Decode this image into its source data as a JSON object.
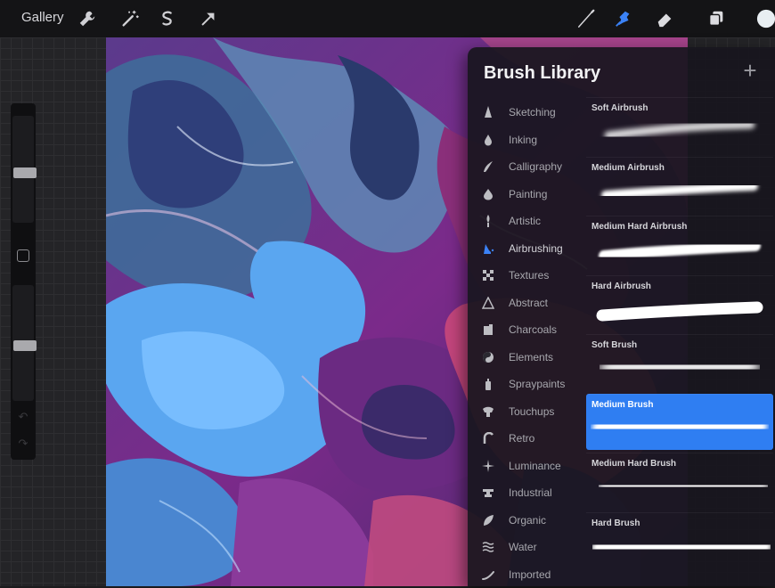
{
  "toolbar": {
    "gallery_label": "Gallery",
    "left_tools": [
      "wrench-icon",
      "magic-wand-icon",
      "selection-icon",
      "transform-icon"
    ],
    "right_tools": [
      "brush-icon",
      "smudge-icon",
      "eraser-icon",
      "layers-icon",
      "color-swatch"
    ],
    "active_tool": "smudge",
    "accent_color": "#3b82f6",
    "current_color": "#e8eef2"
  },
  "panel": {
    "title": "Brush Library",
    "add_label": "+"
  },
  "categories": [
    {
      "label": "Sketching",
      "icon": "pencil-tip-icon"
    },
    {
      "label": "Inking",
      "icon": "ink-drop-icon"
    },
    {
      "label": "Calligraphy",
      "icon": "calligraphy-icon"
    },
    {
      "label": "Painting",
      "icon": "paint-drop-icon"
    },
    {
      "label": "Artistic",
      "icon": "artistic-brush-icon"
    },
    {
      "label": "Airbrushing",
      "icon": "airbrush-icon",
      "active": true
    },
    {
      "label": "Textures",
      "icon": "texture-icon"
    },
    {
      "label": "Abstract",
      "icon": "triangle-icon"
    },
    {
      "label": "Charcoals",
      "icon": "charcoal-icon"
    },
    {
      "label": "Elements",
      "icon": "yin-yang-icon"
    },
    {
      "label": "Spraypaints",
      "icon": "spray-can-icon"
    },
    {
      "label": "Touchups",
      "icon": "touchup-icon"
    },
    {
      "label": "Retro",
      "icon": "retro-icon"
    },
    {
      "label": "Luminance",
      "icon": "sparkle-icon"
    },
    {
      "label": "Industrial",
      "icon": "anvil-icon"
    },
    {
      "label": "Organic",
      "icon": "leaf-icon"
    },
    {
      "label": "Water",
      "icon": "waves-icon"
    },
    {
      "label": "Imported",
      "icon": "imported-icon"
    }
  ],
  "brushes": [
    {
      "name": "Soft Airbrush",
      "stroke": "soft-thin"
    },
    {
      "name": "Medium Airbrush",
      "stroke": "medium-thin"
    },
    {
      "name": "Medium Hard Airbrush",
      "stroke": "medhard-thin"
    },
    {
      "name": "Hard Airbrush",
      "stroke": "hard-thin"
    },
    {
      "name": "Soft Brush",
      "stroke": "soft-thick"
    },
    {
      "name": "Medium Brush",
      "stroke": "medium-thick",
      "selected": true
    },
    {
      "name": "Medium Hard Brush",
      "stroke": "medhard-thick"
    },
    {
      "name": "Hard Brush",
      "stroke": "hard-thick"
    }
  ]
}
